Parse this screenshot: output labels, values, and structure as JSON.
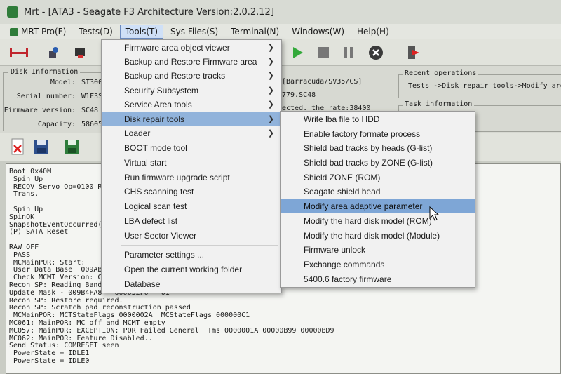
{
  "window": {
    "title": "Mrt - [ATA3 - Seagate F3 Architecture Version:2.0.2.12]"
  },
  "menubar": [
    {
      "label": "MRT Pro(F)"
    },
    {
      "label": "Tests(D)"
    },
    {
      "label": "Tools(T)"
    },
    {
      "label": "Sys Files(S)"
    },
    {
      "label": "Terminal(N)"
    },
    {
      "label": "Windows(W)"
    },
    {
      "label": "Help(H)"
    }
  ],
  "disk_info": {
    "legend": "Disk Information",
    "fields": [
      {
        "label": "Model:",
        "value": "ST300"
      },
      {
        "label": "Serial number:",
        "value": "W1F3S"
      },
      {
        "label": "Firmware version:",
        "value": "SC48"
      },
      {
        "label": "Capacity:",
        "value": "58605"
      }
    ],
    "right_text_1": "[Barracuda/SV35/CS]",
    "right_text_2": "779.SC48",
    "right_text_3": "ected. the rate:38400"
  },
  "recent_ops": {
    "legend": "Recent operations",
    "text": "Tests ->Disk repair tools->Modify area"
  },
  "task_info": {
    "legend": "Task information"
  },
  "console_lines": [
    "Boot 0x40M",
    " Spin Up",
    " RECOV Servo Op=0100 R",
    " Trans.",
    "",
    " Spin Up",
    "SpinOK",
    "SnapshotEventOccurred(",
    "(P) SATA Reset",
    "",
    "RAW OFF",
    " PASS",
    " MCMainPOR: Start:",
    " User Data Base  009AB",
    " Check MCMT Version: C",
    "Recon SP: Reading Band  0031",
    "Update Mask - 009B4FA8 - 000032F0 - 01",
    "Recon SP: Restore required.",
    "Recon SP: Scratch pad reconstruction passed",
    " MCMainPOR: MCTStateFlags 0000002A  MCStateFlags 000000C1",
    "MC061: MainPOR: MC off and MCMT empty",
    "MC057: MainPOR: EXCEPTION: POR Failed General  Tms 0000001A 00000B99 00000BD9",
    "MC062: MainPOR: Feature Disabled..",
    "Send Status: COMRESET seen",
    " PowerState = IDLE1",
    " PowerState = IDLE0"
  ],
  "tools_menu": [
    {
      "label": "Firmware area object viewer",
      "sub": true
    },
    {
      "label": "Backup and Restore Firmware area",
      "sub": true
    },
    {
      "label": "Backup and Restore tracks",
      "sub": true
    },
    {
      "label": "Security Subsystem",
      "sub": true
    },
    {
      "label": "Service Area tools",
      "sub": true
    },
    {
      "label": "Disk repair tools",
      "sub": true
    },
    {
      "label": "Loader",
      "sub": true
    },
    {
      "label": "BOOT mode tool",
      "sub": false
    },
    {
      "label": "Virtual start",
      "sub": false
    },
    {
      "label": "Run firmware upgrade script",
      "sub": false
    },
    {
      "label": "CHS scanning test",
      "sub": false
    },
    {
      "label": "Logical scan test",
      "sub": false
    },
    {
      "label": "LBA defect list",
      "sub": false
    },
    {
      "label": "User Sector Viewer",
      "sub": false
    },
    {
      "label": "Parameter settings ...",
      "sub": false
    },
    {
      "label": "Open the current working folder",
      "sub": false
    },
    {
      "label": "Database",
      "sub": false
    }
  ],
  "disk_repair_submenu": [
    {
      "label": "Write lba file to HDD"
    },
    {
      "label": "Enable factory formate process"
    },
    {
      "label": "Shield bad tracks by heads (G-list)"
    },
    {
      "label": "Shield bad tracks by ZONE (G-list)"
    },
    {
      "label": "Shield ZONE (ROM)"
    },
    {
      "label": "Seagate shield head"
    },
    {
      "label": "Modify area adaptive parameter"
    },
    {
      "label": "Modify the hard disk model (ROM)"
    },
    {
      "label": "Modify the hard disk model (Module)"
    },
    {
      "label": "Firmware unlock"
    },
    {
      "label": "Exchange commands"
    },
    {
      "label": "5400.6 factory firmware"
    }
  ],
  "colors": {
    "highlight": "#91b3db",
    "menu_bg": "#f1f1f1"
  }
}
